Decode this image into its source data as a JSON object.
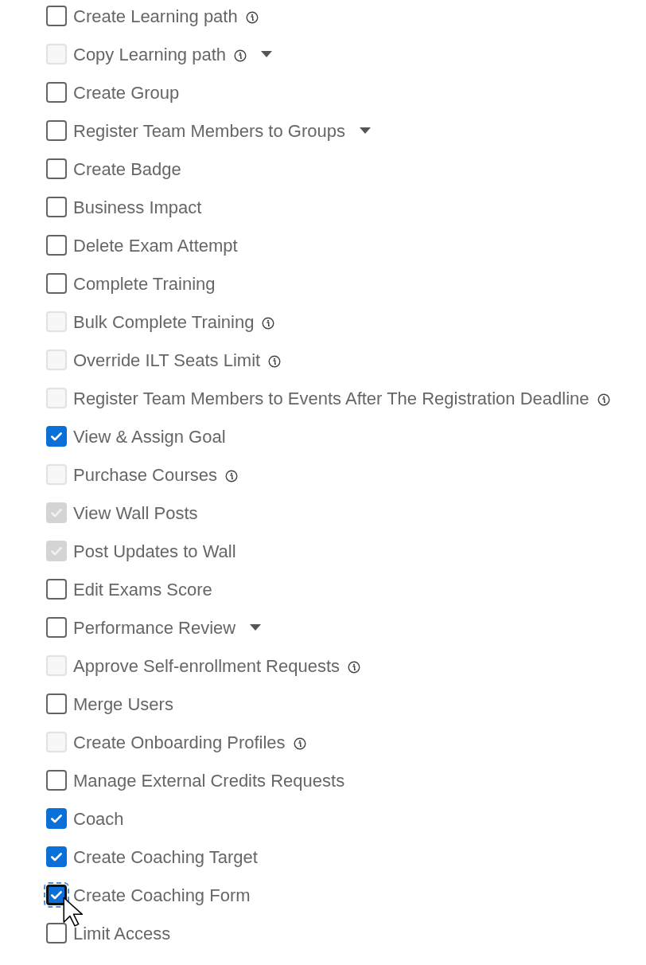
{
  "permissions": [
    {
      "label": "Create Learning path",
      "checked": false,
      "disabled": false,
      "focused": false,
      "info": true,
      "dropdown": false
    },
    {
      "label": "Copy Learning path",
      "checked": false,
      "disabled": true,
      "focused": false,
      "info": true,
      "dropdown": true
    },
    {
      "label": "Create Group",
      "checked": false,
      "disabled": false,
      "focused": false,
      "info": false,
      "dropdown": false
    },
    {
      "label": "Register Team Members to Groups",
      "checked": false,
      "disabled": false,
      "focused": false,
      "info": false,
      "dropdown": true
    },
    {
      "label": "Create Badge",
      "checked": false,
      "disabled": false,
      "focused": false,
      "info": false,
      "dropdown": false
    },
    {
      "label": "Business Impact",
      "checked": false,
      "disabled": false,
      "focused": false,
      "info": false,
      "dropdown": false
    },
    {
      "label": "Delete Exam Attempt",
      "checked": false,
      "disabled": false,
      "focused": false,
      "info": false,
      "dropdown": false
    },
    {
      "label": "Complete Training",
      "checked": false,
      "disabled": false,
      "focused": false,
      "info": false,
      "dropdown": false
    },
    {
      "label": "Bulk Complete Training",
      "checked": false,
      "disabled": true,
      "focused": false,
      "info": true,
      "dropdown": false
    },
    {
      "label": "Override ILT Seats Limit",
      "checked": false,
      "disabled": true,
      "focused": false,
      "info": true,
      "dropdown": false
    },
    {
      "label": "Register Team Members to Events After The Registration Deadline",
      "checked": false,
      "disabled": true,
      "focused": false,
      "info": true,
      "dropdown": false
    },
    {
      "label": "View & Assign Goal",
      "checked": true,
      "disabled": false,
      "focused": false,
      "info": false,
      "dropdown": false
    },
    {
      "label": "Purchase Courses",
      "checked": false,
      "disabled": true,
      "focused": false,
      "info": true,
      "dropdown": false
    },
    {
      "label": "View Wall Posts",
      "checked": true,
      "disabled": true,
      "focused": false,
      "info": false,
      "dropdown": false
    },
    {
      "label": "Post Updates to Wall",
      "checked": true,
      "disabled": true,
      "focused": false,
      "info": false,
      "dropdown": false
    },
    {
      "label": "Edit Exams Score",
      "checked": false,
      "disabled": false,
      "focused": false,
      "info": false,
      "dropdown": false
    },
    {
      "label": "Performance Review",
      "checked": false,
      "disabled": false,
      "focused": false,
      "info": false,
      "dropdown": true
    },
    {
      "label": "Approve Self-enrollment Requests",
      "checked": false,
      "disabled": true,
      "focused": false,
      "info": true,
      "dropdown": false
    },
    {
      "label": "Merge Users",
      "checked": false,
      "disabled": false,
      "focused": false,
      "info": false,
      "dropdown": false
    },
    {
      "label": "Create Onboarding Profiles",
      "checked": false,
      "disabled": true,
      "focused": false,
      "info": true,
      "dropdown": false
    },
    {
      "label": "Manage External Credits Requests",
      "checked": false,
      "disabled": false,
      "focused": false,
      "info": false,
      "dropdown": false
    },
    {
      "label": "Coach",
      "checked": true,
      "disabled": false,
      "focused": false,
      "info": false,
      "dropdown": false
    },
    {
      "label": "Create Coaching Target",
      "checked": true,
      "disabled": false,
      "focused": false,
      "info": false,
      "dropdown": false
    },
    {
      "label": "Create Coaching Form",
      "checked": true,
      "disabled": false,
      "focused": true,
      "info": false,
      "dropdown": false
    },
    {
      "label": "Limit Access",
      "checked": false,
      "disabled": false,
      "focused": false,
      "info": false,
      "dropdown": false
    }
  ]
}
